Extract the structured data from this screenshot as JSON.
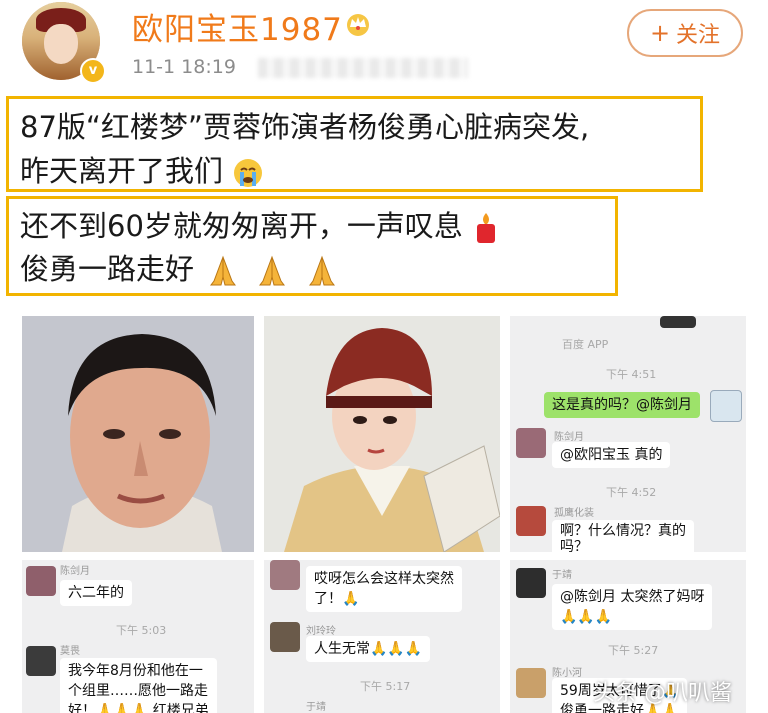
{
  "post": {
    "username": "欧阳宝玉1987",
    "time": "11-1 18:19",
    "follow_label": "关注",
    "line1": "87版“红楼梦”贾蓉饰演者杨俊勇心脏病突发,",
    "line2": "昨天离开了我们",
    "line3": "还不到60岁就匆匆离开，一声叹息",
    "line4": "俊勇一路走好"
  },
  "chat_right_top": {
    "top_caption": "百度 APP",
    "time1": "下午 4:51",
    "q_bubble": "这是真的吗？@陈剑月",
    "name1": "陈剑月",
    "reply1": "@欧阳宝玉 真的",
    "time2": "下午 4:52",
    "name2": "孤鹰化装",
    "reply2a": "啊？什么情况？真的",
    "reply2b": "吗？"
  },
  "chat_left": {
    "name1": "陈剑月",
    "msg1": "六二年的",
    "time1": "下午 5:03",
    "name2": "莫畏",
    "msg2a": "我今年8月份和他在一",
    "msg2b": "个组里……愿他一路走",
    "msg2c": "好！🙏🙏🙏 红楼兄弟"
  },
  "chat_mid": {
    "msg1a": "哎呀怎么会这样太突然",
    "msg1b": "了！🙏",
    "name2": "刘玲玲",
    "msg2": "人生无常🙏🙏🙏",
    "time1": "下午 5:17",
    "name3": "于靖"
  },
  "chat_right_bottom": {
    "name1": "于靖",
    "msg1a": "@陈剑月 太突然了妈呀",
    "msg1b": "🙏🙏🙏",
    "time1": "下午 5:27",
    "name2": "陈小河",
    "msg2a": "59周岁太可惜了🙏",
    "msg2b": "俊勇一路走好🙏🙏"
  },
  "watermark": "头条 @叭叭酱",
  "colors": {
    "username": "#f07a1a",
    "highlight_border": "#f2b400",
    "follow_border": "#e6a77a",
    "wechat_green": "#9de26a"
  }
}
